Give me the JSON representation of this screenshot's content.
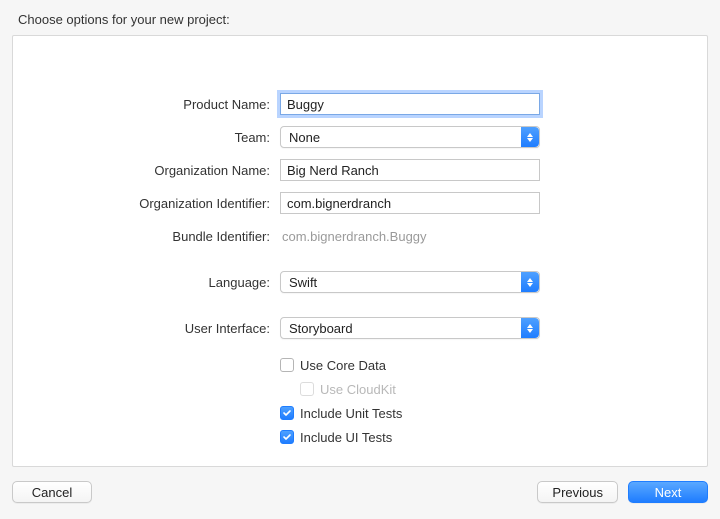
{
  "heading": "Choose options for your new project:",
  "form": {
    "productName": {
      "label": "Product Name:",
      "value": "Buggy"
    },
    "team": {
      "label": "Team:",
      "value": "None"
    },
    "orgName": {
      "label": "Organization Name:",
      "value": "Big Nerd Ranch"
    },
    "orgId": {
      "label": "Organization Identifier:",
      "value": "com.bignerdranch"
    },
    "bundleId": {
      "label": "Bundle Identifier:",
      "value": "com.bignerdranch.Buggy"
    },
    "language": {
      "label": "Language:",
      "value": "Swift"
    },
    "ui": {
      "label": "User Interface:",
      "value": "Storyboard"
    },
    "useCoreData": {
      "label": "Use Core Data",
      "checked": false
    },
    "useCloudKit": {
      "label": "Use CloudKit",
      "checked": false,
      "disabled": true
    },
    "includeUnitTests": {
      "label": "Include Unit Tests",
      "checked": true
    },
    "includeUITests": {
      "label": "Include UI Tests",
      "checked": true
    }
  },
  "buttons": {
    "cancel": "Cancel",
    "previous": "Previous",
    "next": "Next"
  }
}
